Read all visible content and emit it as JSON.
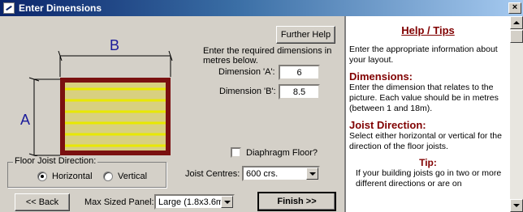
{
  "window": {
    "title": "Enter Dimensions",
    "close_glyph": "×"
  },
  "diagram": {
    "label_a": "A",
    "label_b": "B"
  },
  "buttons": {
    "further_help": "Further Help",
    "back": "<< Back",
    "finish": "Finish >>"
  },
  "instructions": "Enter the required dimensions in metres below.",
  "dimension_a": {
    "label": "Dimension 'A':",
    "value": "6"
  },
  "dimension_b": {
    "label": "Dimension 'B':",
    "value": "8.5"
  },
  "diaphragm": {
    "label": "Diaphragm Floor?",
    "checked": false
  },
  "joist_direction": {
    "legend": "Floor Joist Direction:",
    "options": [
      "Horizontal",
      "Vertical"
    ],
    "selected": "Horizontal"
  },
  "joist_centres": {
    "label": "Joist Centres:",
    "value": "600 crs."
  },
  "max_panel": {
    "label": "Max Sized Panel:",
    "value": "Large (1.8x3.6m)"
  },
  "help": {
    "title": "Help / Tips",
    "intro": "Enter the appropriate information about your layout.",
    "dimensions_heading": "Dimensions:",
    "dimensions_text": "Enter the dimension that relates to the picture. Each value should be in metres (between 1 and 18m).",
    "joist_heading": "Joist Direction:",
    "joist_text": "Select either horizontal or vertical for the direction of the floor joists.",
    "tip_heading": "Tip:",
    "tip_text": "If your building joists go in two or more different directions or are on"
  },
  "colors": {
    "frame": "#7a1010",
    "joist": "#e8e800",
    "floor": "#d8d080",
    "help_heading": "#800000"
  }
}
